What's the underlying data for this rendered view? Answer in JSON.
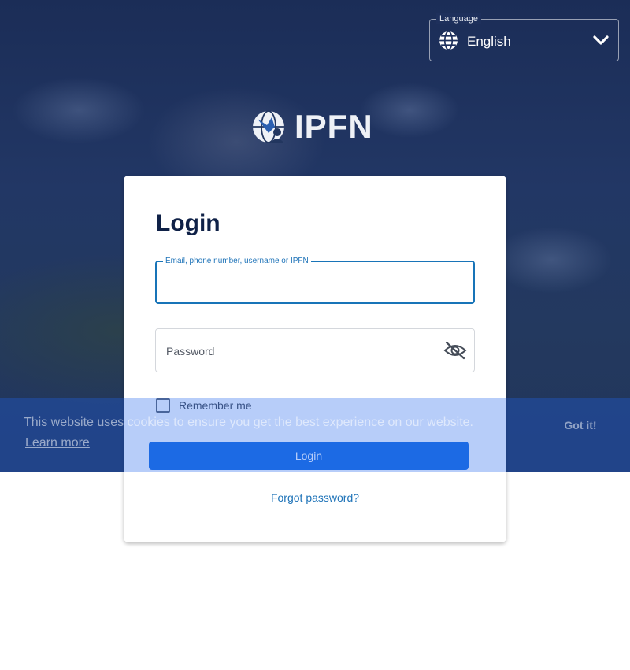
{
  "language": {
    "legend": "Language",
    "selected": "English",
    "icon": "globe-icon",
    "chevron_icon": "chevron-down-icon"
  },
  "brand": {
    "name": "IPFN",
    "icon": "ipfn-logo-icon"
  },
  "login": {
    "title": "Login",
    "email_label": "Email, phone number, username or IPFN",
    "email_value": "",
    "password_placeholder": "Password",
    "password_toggle_icon": "eye-off-icon",
    "remember_label": "Remember me",
    "remember_checked": false,
    "submit_label": "Login",
    "forgot_label": "Forgot password?"
  },
  "cookie": {
    "message": "This website uses cookies to ensure you get the best experience on our website.",
    "learn_more": "Learn more",
    "accept_label": "Got it!"
  },
  "colors": {
    "primary": "#1b6de0",
    "link": "#1e73b8",
    "title": "#0f2147",
    "hero": "#223765"
  }
}
